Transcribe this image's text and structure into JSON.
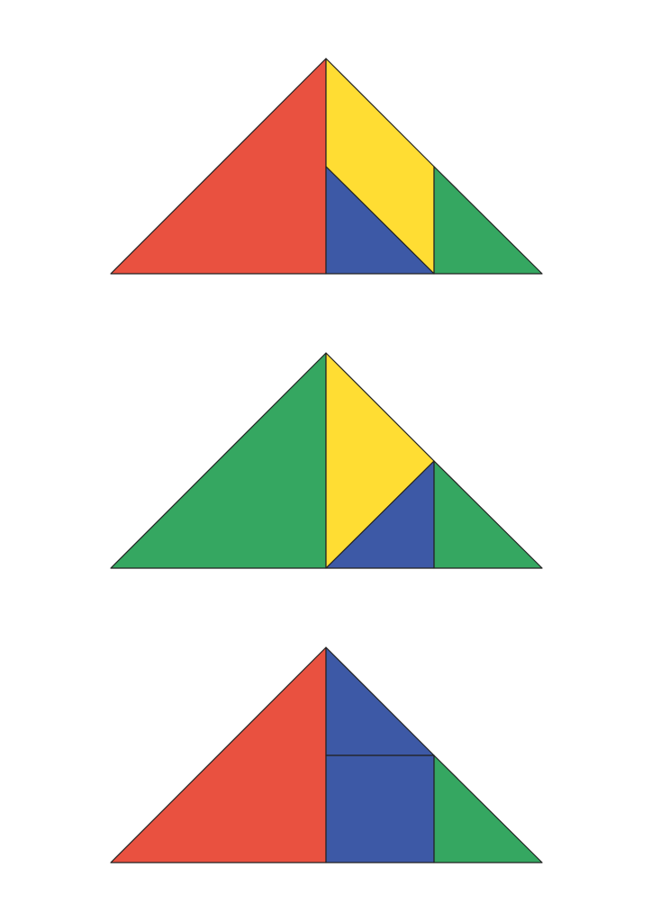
{
  "colors": {
    "red": "#E95140",
    "yellow": "#FFDD33",
    "blue": "#3D59A6",
    "green": "#35A761",
    "outline": "#222222"
  },
  "figures": [
    {
      "name": "tangram-figure-1",
      "pieces": [
        {
          "name": "large-triangle-left",
          "color": "red"
        },
        {
          "name": "parallelogram",
          "color": "yellow"
        },
        {
          "name": "small-triangle-middle",
          "color": "blue"
        },
        {
          "name": "small-triangle-right",
          "color": "green"
        }
      ]
    },
    {
      "name": "tangram-figure-2",
      "pieces": [
        {
          "name": "large-triangle-left",
          "color": "green"
        },
        {
          "name": "medium-triangle-yellow",
          "color": "yellow"
        },
        {
          "name": "small-triangle-middle",
          "color": "blue"
        },
        {
          "name": "small-triangle-right",
          "color": "green"
        }
      ]
    },
    {
      "name": "tangram-figure-3",
      "pieces": [
        {
          "name": "large-triangle-left",
          "color": "red"
        },
        {
          "name": "small-triangle-top",
          "color": "blue"
        },
        {
          "name": "square",
          "color": "blue"
        },
        {
          "name": "small-triangle-right",
          "color": "green"
        }
      ]
    }
  ]
}
